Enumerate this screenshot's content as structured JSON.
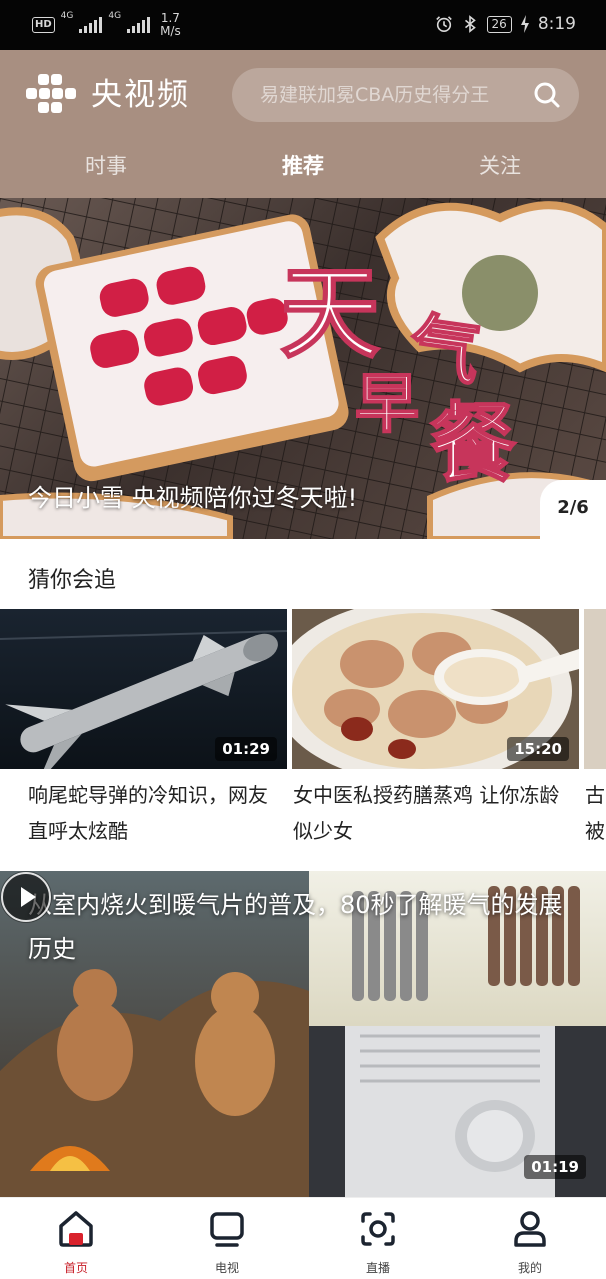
{
  "status_bar": {
    "hd": "HD",
    "hd_sub": "1",
    "net1": "4G",
    "net2": "4G",
    "speed_value": "1.7",
    "speed_unit": "M/s",
    "battery": "26",
    "time": "8:19"
  },
  "header": {
    "app_name": "央视频",
    "search_placeholder": "易建联加冕CBA历史得分王",
    "tabs": [
      {
        "label": "时事",
        "active": false
      },
      {
        "label": "推荐",
        "active": true
      },
      {
        "label": "关注",
        "active": false
      }
    ]
  },
  "banner": {
    "caption": "今日小雪 央视频陪你过冬天啦!",
    "counter": "2/6",
    "art_text": [
      "天",
      "气",
      "早",
      "餐"
    ]
  },
  "section": {
    "title": "猜你会追"
  },
  "recommended": [
    {
      "title": "响尾蛇导弹的冷知识，网友直呼太炫酷",
      "duration": "01:29",
      "thumb": "missile"
    },
    {
      "title": "女中医私授药膳蒸鸡 让你冻龄似少女",
      "duration": "15:20",
      "thumb": "soup"
    },
    {
      "title": "古被",
      "duration": "",
      "thumb": "partial"
    }
  ],
  "feature": {
    "title": "从室内烧火到暖气片的普及，80秒了解暖气的发展历史",
    "duration": "01:19"
  },
  "bottom_nav": [
    {
      "label": "首页",
      "icon": "home-icon",
      "active": true
    },
    {
      "label": "电视",
      "icon": "tv-icon",
      "active": false
    },
    {
      "label": "直播",
      "icon": "live-icon",
      "active": false
    },
    {
      "label": "我的",
      "icon": "profile-icon",
      "active": false
    }
  ],
  "colors": {
    "header_bg": "#a88f81",
    "accent_red": "#c8202a"
  }
}
